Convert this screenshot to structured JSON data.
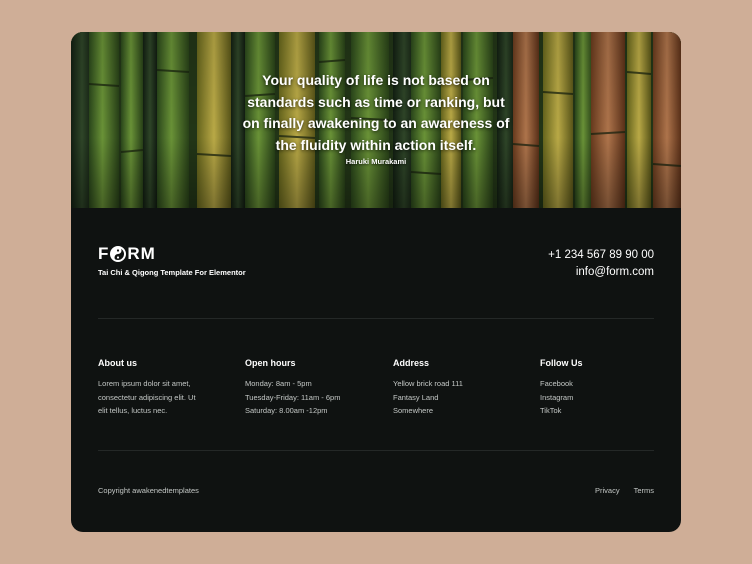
{
  "hero": {
    "quote_lines": [
      "Your quality of life is not based on",
      "standards such as time or ranking, but",
      "on finally awakening to an awareness of",
      "the fluidity within action itself."
    ],
    "author": "Haruki Murakami"
  },
  "brand": {
    "logo_text_left": "F",
    "logo_text_right": "RM",
    "tagline": "Tai Chi & Qigong Template For Elementor"
  },
  "contact": {
    "phone": "+1 234 567 89 90 00",
    "email": "info@form.com"
  },
  "columns": [
    {
      "title": "About us",
      "lines": [
        "Lorem ipsum dolor sit amet,",
        "consectetur adipiscing elit. Ut",
        "elit tellus, luctus nec."
      ]
    },
    {
      "title": "Open hours",
      "lines": [
        "Monday: 8am - 5pm",
        "Tuesday-Friday: 11am - 6pm",
        "Saturday: 8.00am -12pm"
      ]
    },
    {
      "title": "Address",
      "lines": [
        "Yellow brick road 111",
        "Fantasy Land",
        "Somewhere"
      ]
    },
    {
      "title": "Follow Us",
      "lines": [
        "Facebook",
        "Instagram",
        "TikTok"
      ]
    }
  ],
  "bottom": {
    "copyright": "Copyright awakenedtemplates",
    "privacy": "Privacy",
    "terms": "Terms"
  },
  "colors": {
    "page_background": "#cfae97",
    "footer_background": "#0f1211",
    "text": "#ffffff",
    "muted_text": "#c4c8c6"
  }
}
